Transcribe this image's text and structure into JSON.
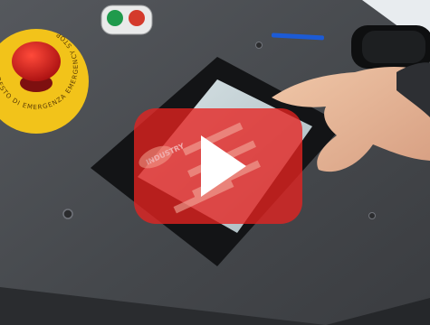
{
  "emergency_stop": {
    "ring_text": "ARRESTO DI EMERGENZA EMERGENCY STOP",
    "ring_color": "#f2c31a",
    "button_color": "#d01a1a"
  },
  "hmi_screen": {
    "logo_text": "INDUSTRY",
    "screen_tint": "#e0301f"
  },
  "video_overlay": {
    "play_button_color": "#e52220",
    "icon": "play-icon"
  },
  "colors": {
    "panel": "#4a4d52",
    "bezel": "#141517",
    "pen": "#1c5bd6"
  }
}
